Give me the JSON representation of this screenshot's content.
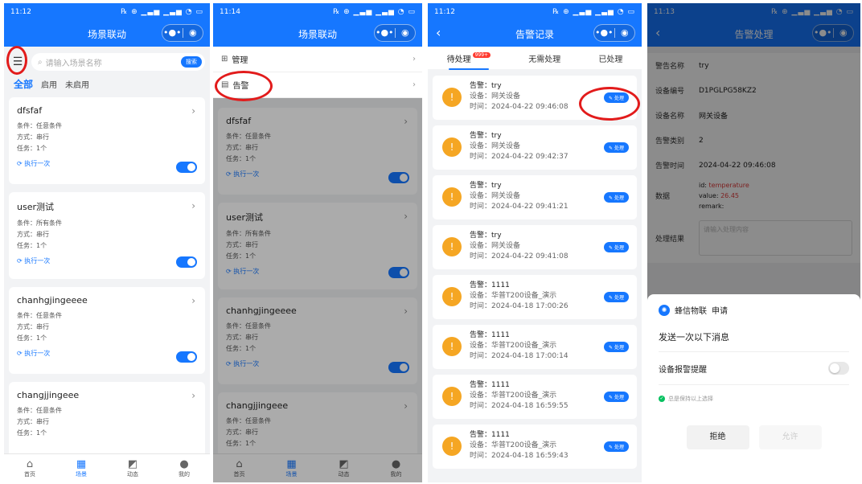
{
  "phone1": {
    "time": "11:12",
    "status_icons": "℞ ⊕ ▁▃▅ ▁▃▅ ◔ ▭",
    "title": "场景联动",
    "search_placeholder": "请输入场景名称",
    "search_button": "搜索",
    "filters": [
      "全部",
      "启用",
      "未启用"
    ],
    "cards": [
      {
        "name": "dfsfaf",
        "cond": "条件：任意条件",
        "mode": "方式：串行",
        "task": "任务：1个",
        "run": "执行一次"
      },
      {
        "name": "user测试",
        "cond": "条件：所有条件",
        "mode": "方式：串行",
        "task": "任务：1个",
        "run": "执行一次"
      },
      {
        "name": "chanhgjingeeee",
        "cond": "条件：任意条件",
        "mode": "方式：串行",
        "task": "任务：1个",
        "run": "执行一次"
      },
      {
        "name": "changjjingeee",
        "cond": "条件：任意条件",
        "mode": "方式：串行",
        "task": "任务：1个",
        "run": ""
      }
    ],
    "tabs": [
      "首页",
      "场景",
      "动态",
      "我的"
    ]
  },
  "phone2": {
    "time": "11:14",
    "title": "场景联动",
    "menu": [
      "管理",
      "告警"
    ],
    "cards": [
      {
        "name": "dfsfaf",
        "cond": "条件：任意条件",
        "mode": "方式：串行",
        "task": "任务：1个",
        "run": "执行一次"
      },
      {
        "name": "user测试",
        "cond": "条件：所有条件",
        "mode": "方式：串行",
        "task": "任务：1个",
        "run": "执行一次"
      },
      {
        "name": "chanhgjingeeee",
        "cond": "条件：任意条件",
        "mode": "方式：串行",
        "task": "任务：1个",
        "run": "执行一次"
      },
      {
        "name": "changjjingeee",
        "cond": "条件：任意条件",
        "mode": "方式：串行",
        "task": "任务：1个",
        "run": ""
      }
    ],
    "tabs": [
      "首页",
      "场景",
      "动态",
      "我的"
    ]
  },
  "phone3": {
    "time": "11:12",
    "title": "告警记录",
    "subtabs": [
      "待处理",
      "无需处理",
      "已处理"
    ],
    "badge": "999+",
    "action": "处理",
    "alarms": [
      {
        "t": "告警：try",
        "d": "设备：网关设备",
        "time": "时间：2024-04-22 09:46:08"
      },
      {
        "t": "告警：try",
        "d": "设备：网关设备",
        "time": "时间：2024-04-22 09:42:37"
      },
      {
        "t": "告警：try",
        "d": "设备：网关设备",
        "time": "时间：2024-04-22 09:41:21"
      },
      {
        "t": "告警：try",
        "d": "设备：网关设备",
        "time": "时间：2024-04-22 09:41:08"
      },
      {
        "t": "告警：1111",
        "d": "设备：华普T200设备_演示",
        "time": "时间：2024-04-18 17:00:26"
      },
      {
        "t": "告警：1111",
        "d": "设备：华普T200设备_演示",
        "time": "时间：2024-04-18 17:00:14"
      },
      {
        "t": "告警：1111",
        "d": "设备：华普T200设备_演示",
        "time": "时间：2024-04-18 16:59:55"
      },
      {
        "t": "告警：1111",
        "d": "设备：华普T200设备_演示",
        "time": "时间：2024-04-18 16:59:43"
      }
    ]
  },
  "phone4": {
    "time": "11:13",
    "title": "告警处理",
    "fields": [
      {
        "k": "警告名称",
        "v": "try"
      },
      {
        "k": "设备编号",
        "v": "D1PGLPG58KZ2"
      },
      {
        "k": "设备名称",
        "v": "网关设备"
      },
      {
        "k": "告警类别",
        "v": "2"
      },
      {
        "k": "告警时间",
        "v": "2024-04-22 09:46:08"
      }
    ],
    "data_label": "数据",
    "data_id_k": "id:",
    "data_id_v": "temperature",
    "data_value_k": "value:",
    "data_value_v": "26.45",
    "data_remark": "remark:",
    "result_label": "处理结果",
    "result_placeholder": "请输入处理内容",
    "sheet_app": "蜂信物联",
    "sheet_req": "申请",
    "sheet_msg": "发送一次以下消息",
    "sheet_opt": "设备报警提醒",
    "sheet_keep": "总是保持以上选择",
    "reject": "拒绝",
    "allow": "允许"
  }
}
